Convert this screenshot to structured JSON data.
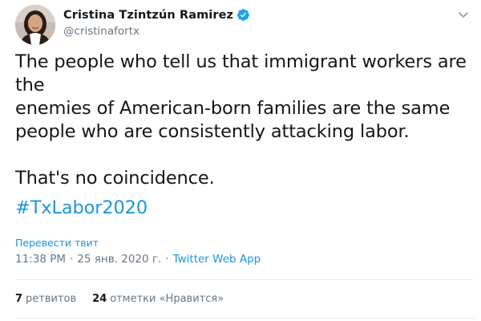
{
  "author": {
    "display_name": "Cristina Tzintzún Ramirez",
    "handle": "@cristinafortx",
    "verified": true,
    "avatar_icon": "profile-photo"
  },
  "tweet": {
    "text": "The people who tell us that immigrant workers are the\nenemies of American-born families are the same\npeople who are consistently attacking labor.\n\nThat's no coincidence.",
    "hashtag": "#TxLabor2020",
    "translate_label": "Перевести твит"
  },
  "meta": {
    "time": "11:38 PM",
    "date": "25 янв. 2020 г.",
    "separator": "·",
    "app": "Twitter Web App"
  },
  "stats": {
    "retweets_count": "7",
    "retweets_label": "ретвитов",
    "likes_count": "24",
    "likes_label": "отметки «Нравится»"
  },
  "colors": {
    "link": "#1b95e0",
    "secondary_text": "#657786",
    "primary_text": "#14171a",
    "verified_badge": "#1da1f2"
  }
}
